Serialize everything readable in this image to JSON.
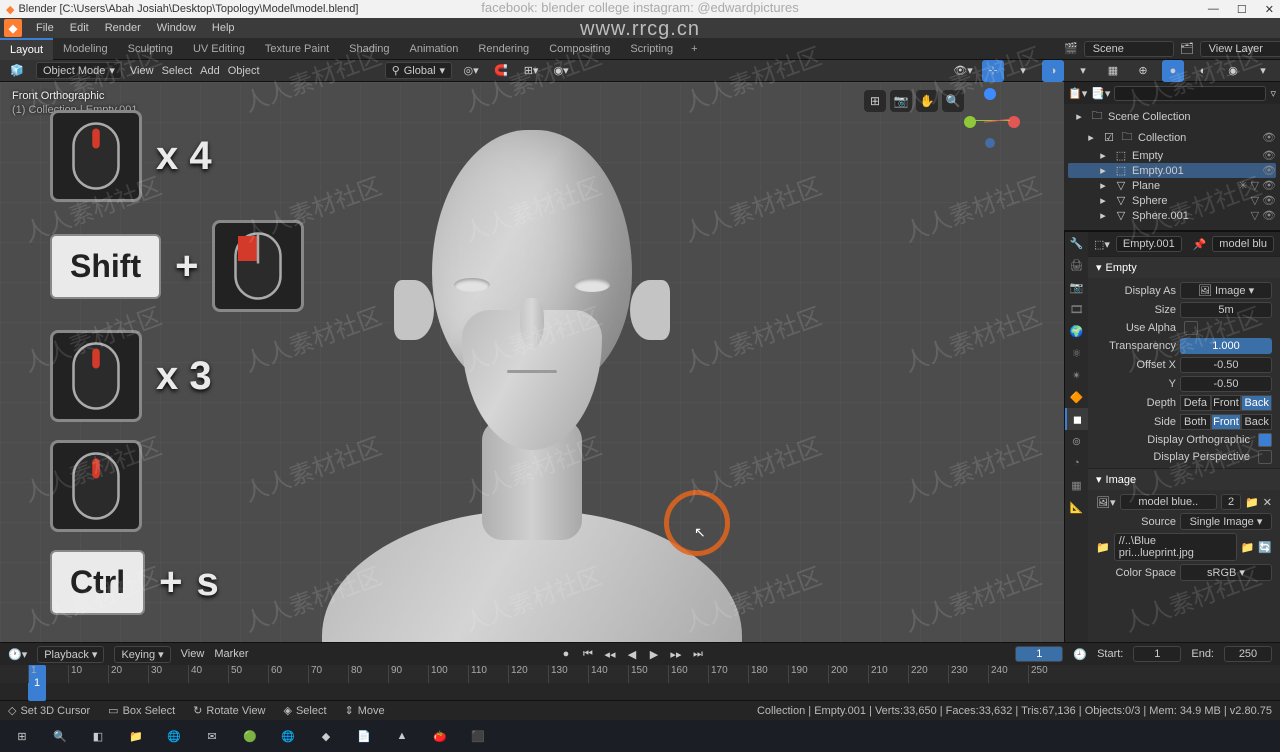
{
  "titlebar": {
    "icon": "◆",
    "path": "Blender [C:\\Users\\Abah Josiah\\Desktop\\Topology\\Model\\model.blend]"
  },
  "social": "facebook: blender college   instagram: @edwardpictures",
  "wmurl": "www.rrcg.cn",
  "wmtext": "人人素材社区",
  "menu": {
    "items": [
      "File",
      "Edit",
      "Render",
      "Window",
      "Help"
    ]
  },
  "workspaces": {
    "tabs": [
      "Layout",
      "Modeling",
      "Sculpting",
      "UV Editing",
      "Texture Paint",
      "Shading",
      "Animation",
      "Rendering",
      "Compositing",
      "Scripting"
    ],
    "active": 0,
    "scene_label": "Scene",
    "viewlayer_label": "View Layer"
  },
  "toolheader": {
    "editor": "⬚",
    "mode": "Object Mode",
    "view": "View",
    "select": "Select",
    "add": "Add",
    "object": "Object",
    "orient": "Global"
  },
  "viewport": {
    "info_line1": "Front Orthographic",
    "info_line2": "(1) Collection | Empty.001"
  },
  "shortcuts": {
    "row1": "x 4",
    "row2_key": "Shift",
    "row2_plus": "+",
    "row3": "x 3",
    "row5_key": "Ctrl",
    "row5_plus": "+",
    "row5_s": "s"
  },
  "outliner": {
    "search_placeholder": "",
    "items": [
      {
        "indent": 0,
        "icon": "🗀",
        "name": "Scene Collection",
        "toggle": "",
        "rt": []
      },
      {
        "indent": 1,
        "icon": "🗀",
        "name": "Collection",
        "rt": [
          "👁"
        ],
        "chk": true
      },
      {
        "indent": 2,
        "icon": "⬚",
        "name": "Empty",
        "rt": [
          "👁"
        ]
      },
      {
        "indent": 2,
        "icon": "⬚",
        "name": "Empty.001",
        "rt": [
          "👁"
        ],
        "sel": true
      },
      {
        "indent": 2,
        "icon": "▽",
        "name": "Plane",
        "rt": [
          "✳",
          "▽",
          "👁"
        ]
      },
      {
        "indent": 2,
        "icon": "▽",
        "name": "Sphere",
        "rt": [
          "▽",
          "👁"
        ]
      },
      {
        "indent": 2,
        "icon": "▽",
        "name": "Sphere.001",
        "rt": [
          "▽",
          "👁"
        ]
      }
    ]
  },
  "properties": {
    "header_left": "Empty.001",
    "header_right": "model blu",
    "section_empty": "Empty",
    "display_as_label": "Display As",
    "display_as_value": "Image",
    "size_label": "Size",
    "size_value": "5m",
    "use_alpha_label": "Use Alpha",
    "transparency_label": "Transparency",
    "transparency_value": "1.000",
    "offx_label": "Offset X",
    "offx_value": "-0.50",
    "offy_label": "Y",
    "offy_value": "-0.50",
    "depth_label": "Depth",
    "depth_opts": [
      "Defa",
      "Front",
      "Back"
    ],
    "depth_active": 2,
    "side_label": "Side",
    "side_opts": [
      "Both",
      "Front",
      "Back"
    ],
    "side_active": 1,
    "disp_ortho_label": "Display Orthographic",
    "disp_ortho": true,
    "disp_persp_label": "Display Perspective",
    "disp_persp": false,
    "section_image": "Image",
    "img_name": "model blue..",
    "img_users": "2",
    "source_label": "Source",
    "source_value": "Single Image",
    "path_value": "//..\\Blue pri...lueprint.jpg",
    "colorspace_label": "Color Space",
    "colorspace_value": "sRGB"
  },
  "timeline": {
    "menus": [
      "Playback",
      "Keying",
      "View",
      "Marker"
    ],
    "frame_current": "1",
    "start_label": "Start:",
    "start": "1",
    "end_label": "End:",
    "end": "250",
    "ticks": [
      1,
      10,
      20,
      30,
      40,
      50,
      60,
      70,
      80,
      90,
      100,
      110,
      120,
      130,
      140,
      150,
      160,
      170,
      180,
      190,
      200,
      210,
      220,
      230,
      240,
      250
    ]
  },
  "status": {
    "items": [
      {
        "icon": "◇",
        "label": "Set 3D Cursor"
      },
      {
        "icon": "▭",
        "label": "Box Select"
      },
      {
        "icon": "↻",
        "label": "Rotate View"
      },
      {
        "icon": "◈",
        "label": "Select"
      },
      {
        "icon": "⇕",
        "label": "Move"
      }
    ],
    "right": "Collection | Empty.001 | Verts:33,650 | Faces:33,632 | Tris:67,136 | Objects:0/3 | Mem: 34.9 MB | v2.80.75"
  },
  "taskbar": {
    "items": [
      "⊞",
      "🔍",
      "◧",
      "📁",
      "🌐",
      "✉",
      "🟢",
      "🌐",
      "◆",
      "📄",
      "▲",
      "🍅",
      "⬛"
    ]
  },
  "prop_tabs": [
    "🔧",
    "🖨",
    "📷",
    "🎞",
    "🌍",
    "⚛",
    "✴",
    "🔶",
    "◼",
    "⊚",
    "◔",
    "▦",
    "📐"
  ]
}
